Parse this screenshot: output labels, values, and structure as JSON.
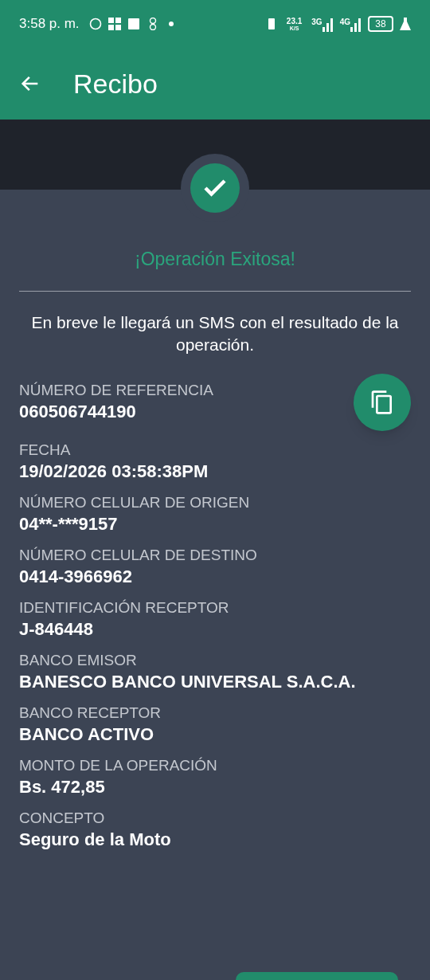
{
  "status_bar": {
    "time": "3:58 p. m.",
    "speed": "23.1",
    "speed_unit": "K/S",
    "network_1": "3G",
    "network_2": "4G",
    "battery": "38"
  },
  "header": {
    "title": "Recibo"
  },
  "result": {
    "title": "¡Operación Exitosa!",
    "message": "En breve le llegará un SMS con el resultado de la operación."
  },
  "fields": [
    {
      "label": "NÚMERO DE REFERENCIA",
      "value": "060506744190",
      "copyable": true
    },
    {
      "label": "FECHA",
      "value": "19/02/2026 03:58:38PM",
      "copyable": false
    },
    {
      "label": "NÚMERO CELULAR DE ORIGEN",
      "value": "04**-***9157",
      "copyable": false
    },
    {
      "label": "NÚMERO CELULAR DE DESTINO",
      "value": "0414-3966962",
      "copyable": false
    },
    {
      "label": "IDENTIFICACIÓN RECEPTOR",
      "value": "J-846448",
      "copyable": false
    },
    {
      "label": "BANCO EMISOR",
      "value": "BANESCO BANCO UNIVERSAL S.A.C.A.",
      "copyable": false
    },
    {
      "label": "BANCO RECEPTOR",
      "value": "BANCO ACTIVO",
      "copyable": false
    },
    {
      "label": "MONTO DE LA OPERACIÓN",
      "value": "Bs. 472,85",
      "copyable": false
    },
    {
      "label": "CONCEPTO",
      "value": "Seguro de la Moto",
      "copyable": false
    }
  ]
}
